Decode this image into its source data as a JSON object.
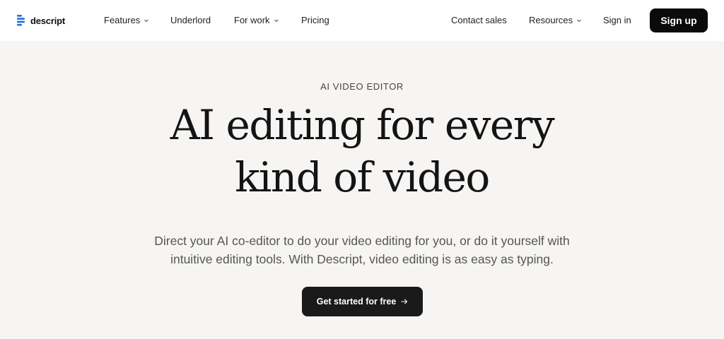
{
  "brand": {
    "name": "descript",
    "logo_icon": "descript-logo-icon"
  },
  "nav": {
    "left_items": [
      {
        "label": "Features",
        "has_dropdown": true
      },
      {
        "label": "Underlord",
        "has_dropdown": false
      },
      {
        "label": "For work",
        "has_dropdown": true
      },
      {
        "label": "Pricing",
        "has_dropdown": false
      }
    ],
    "right_items": [
      {
        "label": "Contact sales",
        "has_dropdown": false
      },
      {
        "label": "Resources",
        "has_dropdown": true
      },
      {
        "label": "Sign in",
        "has_dropdown": false
      }
    ],
    "signup_label": "Sign up"
  },
  "hero": {
    "eyebrow": "AI VIDEO EDITOR",
    "headline_line1": "AI editing for every",
    "headline_line2": "kind of video",
    "sub_line1": "Direct your AI co-editor to do your video editing for you, or do it yourself with",
    "sub_line2": "intuitive editing tools. With Descript, video editing is as easy as typing.",
    "cta_label": "Get started for free",
    "cta_icon": "arrow-right-icon"
  },
  "colors": {
    "page_bg": "#f6f5f3",
    "nav_bg": "#ffffff",
    "button_bg": "#0b0b0b",
    "logo_accent": "#1a73e8"
  }
}
